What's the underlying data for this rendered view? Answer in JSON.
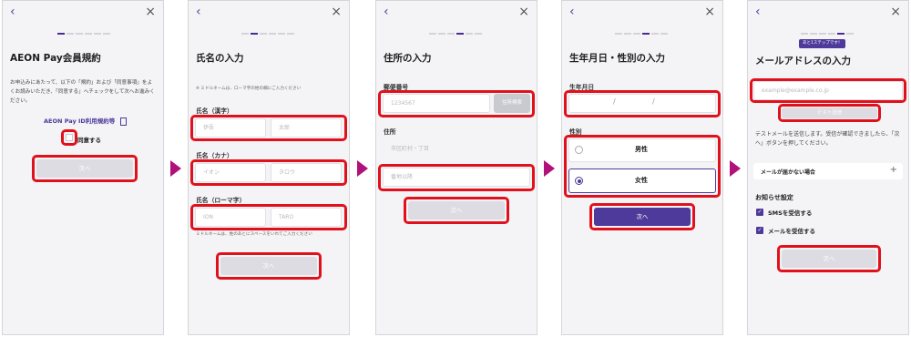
{
  "nav": {
    "back_icon": "‹",
    "close_icon": "×"
  },
  "s1": {
    "title": "AEON Pay会員規約",
    "description": "お申込みにあたって、以下の「規約」および「同意事項」をよくお読みいただき、「同意する」へチェックをして次へお進みください。",
    "terms_link": "AEON Pay ID利用規約等",
    "agree_label": "同意する",
    "next_label": "次へ"
  },
  "s2": {
    "title": "氏名の入力",
    "note": "※ ミドルネームは、ローマ字の姓の欄にご入力ください",
    "kanji": {
      "label": "氏名（漢字）",
      "last_placeholder": "伊吾",
      "first_placeholder": "太郎"
    },
    "kana": {
      "label": "氏名（カナ）",
      "last_placeholder": "イオン",
      "first_placeholder": "タロウ"
    },
    "roman": {
      "label": "氏名（ローマ字）",
      "last_placeholder": "ION",
      "first_placeholder": "TARO"
    },
    "roman_note": "ミドルネームは、姓のあとにスペースをいれてご入力ください",
    "next_label": "次へ"
  },
  "s3": {
    "title": "住所の入力",
    "postal_label": "郵便番号",
    "postal_placeholder": "1234567",
    "search_label": "住所検索",
    "address_label": "住所",
    "city_placeholder": "市区町村・丁目",
    "street_placeholder": "番地以降",
    "next_label": "次へ"
  },
  "s4": {
    "title": "生年月日・性別の入力",
    "dob_label": "生年月日",
    "date_separator": "/",
    "gender_label": "性別",
    "male_label": "男性",
    "female_label": "女性",
    "next_label": "次へ"
  },
  "s5": {
    "badge": "あと1ステップです！",
    "title": "メールアドレスの入力",
    "email_placeholder": "example@example.co.jp",
    "test_send_label": "テスト送信",
    "description": "テストメールを送信します。受信が確認できましたら、「次へ」ボタンを押してください。",
    "no_mail_label": "メールが届かない場合",
    "expand_icon": "+",
    "notify_title": "お知らせ設定",
    "sms_label": "SMSを受信する",
    "mail_label": "メールを受信する",
    "next_label": "次へ"
  },
  "colors": {
    "accent": "#4e3a9a",
    "highlight": "#e1111c",
    "step_arrow": "#b0127a"
  }
}
